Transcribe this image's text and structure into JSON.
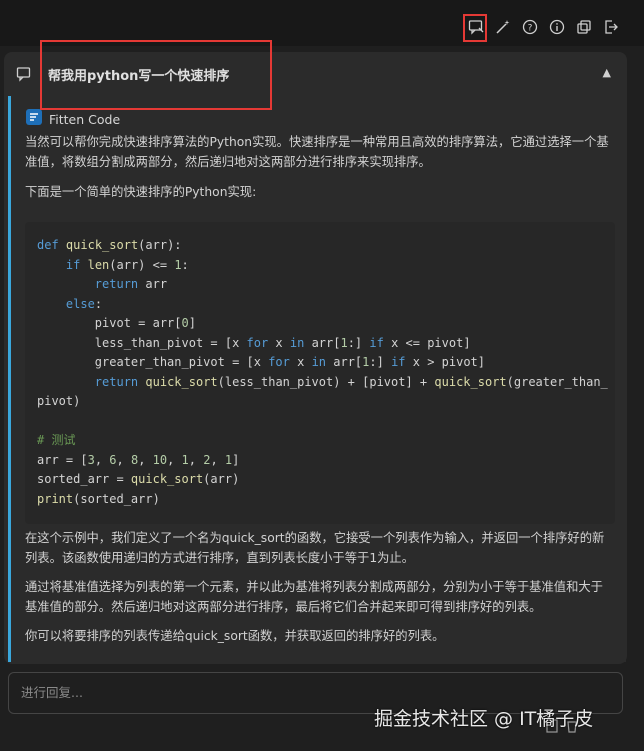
{
  "toolbar": {
    "icons": [
      "chat-icon",
      "magic-wand-icon",
      "help-icon",
      "info-icon",
      "copy-icon",
      "exit-icon"
    ],
    "highlight_color": "#e53935"
  },
  "conversation": {
    "title": "帮我用python写一个快速排序",
    "collapse_glyph": "▲",
    "author": "Fitten Code",
    "intro": "当然可以帮你完成快速排序算法的Python实现。快速排序是一种常用且高效的排序算法，它通过选择一个基准值，将数组分割成两部分，然后递归地对这两部分进行排序来实现排序。",
    "lead": "下面是一个简单的快速排序的Python实现:",
    "code_lines": [
      "def quick_sort(arr):",
      "    if len(arr) <= 1:",
      "        return arr",
      "    else:",
      "        pivot = arr[0]",
      "        less_than_pivot = [x for x in arr[1:] if x <= pivot]",
      "        greater_than_pivot = [x for x in arr[1:] if x > pivot]",
      "        return quick_sort(less_than_pivot) + [pivot] + quick_sort(greater_than_pivot)",
      "",
      "# 测试",
      "arr = [3, 6, 8, 10, 1, 2, 1]",
      "sorted_arr = quick_sort(arr)",
      "print(sorted_arr)"
    ],
    "para1": "在这个示例中，我们定义了一个名为quick_sort的函数，它接受一个列表作为输入，并返回一个排序好的新列表。该函数使用递归的方式进行排序，直到列表长度小于等于1为止。",
    "para2": "通过将基准值选择为列表的第一个元素，并以此为基准将列表分割成两部分，分别为小于等于基准值和大于基准值的部分。然后递归地对这两部分进行排序，最后将它们合并起来即可得到排序好的列表。",
    "para3": "你可以将要排序的列表传递给quick_sort函数，并获取返回的排序好的列表。"
  },
  "reply_input": {
    "placeholder": "进行回复..."
  },
  "watermark": "掘金技术社区 @ IT橘子皮",
  "accent_color": "#3aa7dc"
}
